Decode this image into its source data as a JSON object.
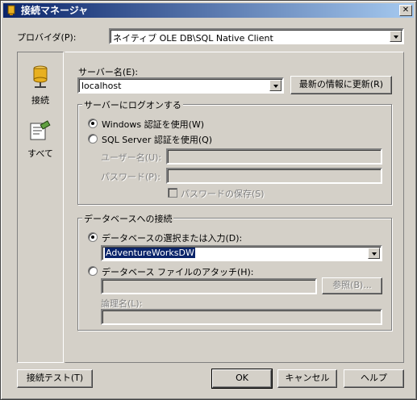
{
  "window": {
    "title": "接続マネージャ"
  },
  "provider": {
    "label": "プロバイダ(P):",
    "value": "ネイティブ OLE DB\\SQL Native Client"
  },
  "sidebar": {
    "items": [
      {
        "label": "接続"
      },
      {
        "label": "すべて"
      }
    ]
  },
  "server": {
    "label": "サーバー名(E):",
    "value": "localhost",
    "refresh_label": "最新の情報に更新(R)"
  },
  "logon": {
    "group_title": "サーバーにログオンする",
    "windows_auth_label": "Windows 認証を使用(W)",
    "sql_auth_label": "SQL Server 認証を使用(Q)",
    "username_label": "ユーザー名(U):",
    "password_label": "パスワード(P):",
    "save_password_label": "パスワードの保存(S)"
  },
  "database": {
    "group_title": "データベースへの接続",
    "select_label": "データベースの選択または入力(D):",
    "select_value": "AdventureWorksDW",
    "attach_label": "データベース ファイルのアタッチ(H):",
    "browse_label": "参照(B)...",
    "logical_name_label": "論理名(L):"
  },
  "footer": {
    "test_label": "接続テスト(T)",
    "ok_label": "OK",
    "cancel_label": "キャンセル",
    "help_label": "ヘルプ"
  }
}
